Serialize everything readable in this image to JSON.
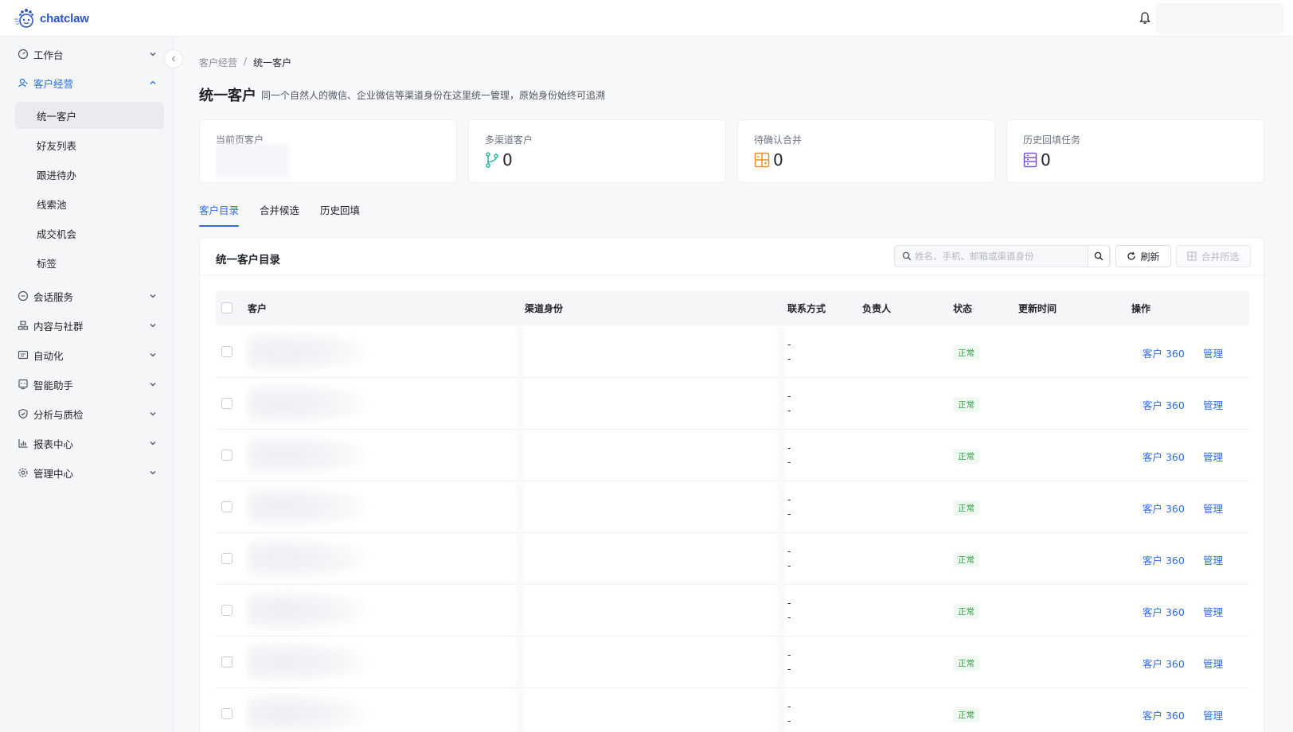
{
  "app": {
    "name": "chatclaw",
    "brand_color": "#2d6cdf"
  },
  "sidebar": {
    "groups": [
      {
        "label": "工作台",
        "icon": "dashboard-icon"
      },
      {
        "label": "客户经营",
        "icon": "customers-icon",
        "expanded": true
      },
      {
        "label": "会话服务",
        "icon": "chat-icon"
      },
      {
        "label": "内容与社群",
        "icon": "community-icon"
      },
      {
        "label": "自动化",
        "icon": "automation-icon"
      },
      {
        "label": "智能助手",
        "icon": "assistant-icon"
      },
      {
        "label": "分析与质检",
        "icon": "shield-icon"
      },
      {
        "label": "报表中心",
        "icon": "bar-chart-icon"
      },
      {
        "label": "管理中心",
        "icon": "gear-icon"
      }
    ],
    "sub_items": [
      "统一客户",
      "好友列表",
      "跟进待办",
      "线索池",
      "成交机会",
      "标签"
    ],
    "selected_sub": "统一客户"
  },
  "breadcrumb": {
    "parent": "客户经营",
    "separator": "/",
    "current": "统一客户"
  },
  "page": {
    "title": "统一客户",
    "description": "同一个自然人的微信、企业微信等渠道身份在这里统一管理，原始身份始终可追溯"
  },
  "stats": [
    {
      "label": "当前页客户",
      "value": ""
    },
    {
      "label": "多渠道客户",
      "value": "0",
      "icon": "branch-icon",
      "color": "#2bb5a0"
    },
    {
      "label": "待确认合并",
      "value": "0",
      "icon": "merge-icon",
      "color": "#e0932b"
    },
    {
      "label": "历史回填任务",
      "value": "0",
      "icon": "list-icon",
      "color": "#7b55d6"
    }
  ],
  "tabs": [
    {
      "label": "客户目录",
      "active": true
    },
    {
      "label": "合并候选"
    },
    {
      "label": "历史回填"
    }
  ],
  "directory": {
    "title": "统一客户目录",
    "search_placeholder": "姓名、手机、邮箱或渠道身份",
    "refresh_label": "刷新",
    "merge_label": "合并所选",
    "columns": [
      "客户",
      "渠道身份",
      "联系方式",
      "负责人",
      "状态",
      "更新时间",
      "操作"
    ],
    "rows": [
      {
        "contact1": "-",
        "contact2": "-",
        "status": "正常",
        "action1": "客户 360",
        "action2": "管理"
      },
      {
        "contact1": "-",
        "contact2": "-",
        "status": "正常",
        "action1": "客户 360",
        "action2": "管理"
      },
      {
        "contact1": "-",
        "contact2": "-",
        "status": "正常",
        "action1": "客户 360",
        "action2": "管理"
      },
      {
        "contact1": "-",
        "contact2": "-",
        "status": "正常",
        "action1": "客户 360",
        "action2": "管理"
      },
      {
        "contact1": "-",
        "contact2": "-",
        "status": "正常",
        "action1": "客户 360",
        "action2": "管理"
      },
      {
        "contact1": "-",
        "contact2": "-",
        "status": "正常",
        "action1": "客户 360",
        "action2": "管理"
      },
      {
        "contact1": "-",
        "contact2": "-",
        "status": "正常",
        "action1": "客户 360",
        "action2": "管理"
      },
      {
        "contact1": "-",
        "contact2": "-",
        "status": "正常",
        "action1": "客户 360",
        "action2": "管理"
      }
    ]
  }
}
